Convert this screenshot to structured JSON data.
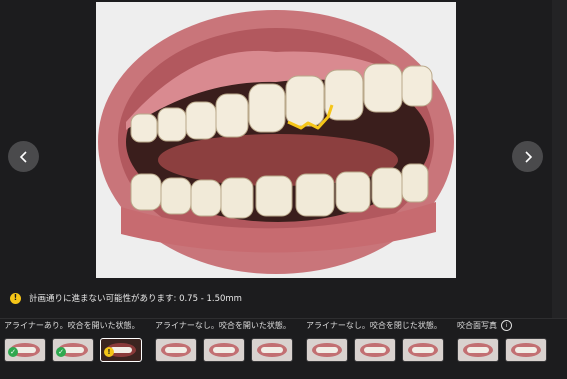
{
  "viewer": {
    "prev_icon": "chevron-left-icon",
    "next_icon": "chevron-right-icon",
    "highlight_color": "#f5c518"
  },
  "warning": {
    "icon": "warning-icon",
    "icon_glyph": "!",
    "text": "計画通りに進まない可能性があります: 0.75 - 1.50mm"
  },
  "groups": [
    {
      "label": "アライナーあり。咬合を開いた状態。",
      "thumbnails": [
        {
          "status": "ok",
          "status_glyph": "✓",
          "active": false
        },
        {
          "status": "ok",
          "status_glyph": "✓",
          "active": false
        },
        {
          "status": "warning",
          "status_glyph": "!",
          "active": true
        }
      ]
    },
    {
      "label": "アライナーなし。咬合を開いた状態。",
      "thumbnails": [
        {
          "status": "none",
          "active": false
        },
        {
          "status": "none",
          "active": false
        },
        {
          "status": "none",
          "active": false
        }
      ]
    },
    {
      "label": "アライナーなし。咬合を閉じた状態。",
      "thumbnails": [
        {
          "status": "none",
          "active": false
        },
        {
          "status": "none",
          "active": false
        },
        {
          "status": "none",
          "active": false
        }
      ]
    },
    {
      "label": "咬合面写真",
      "info_icon": "info-icon",
      "info_glyph": "i",
      "thumbnails": [
        {
          "status": "none",
          "active": false
        },
        {
          "status": "none",
          "active": false
        }
      ]
    }
  ]
}
